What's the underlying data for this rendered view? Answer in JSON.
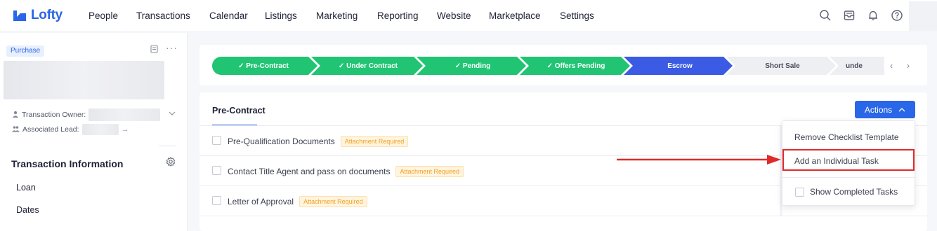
{
  "brand": {
    "name": "Lofty",
    "color": "#2a66e8"
  },
  "nav": {
    "items": [
      "People",
      "Transactions",
      "Calendar",
      "Listings",
      "Marketing",
      "Reporting",
      "Website",
      "Marketplace",
      "Settings"
    ],
    "icons": [
      "search-icon",
      "inbox-icon",
      "bell-icon",
      "help-icon"
    ]
  },
  "sidebar": {
    "tag": "Purchase",
    "owner_label": "Transaction Owner:",
    "lead_label": "Associated Lead:",
    "lead_arrow": "→",
    "section_title": "Transaction Information",
    "links": [
      "Loan",
      "Dates"
    ]
  },
  "stages": [
    {
      "label": "✓ Pre-Contract",
      "state": "done"
    },
    {
      "label": "✓ Under Contract",
      "state": "done"
    },
    {
      "label": "✓ Pending",
      "state": "done"
    },
    {
      "label": "✓ Offers Pending",
      "state": "done"
    },
    {
      "label": "Escrow",
      "state": "current"
    },
    {
      "label": "Short Sale",
      "state": "future"
    },
    {
      "label": "unde",
      "state": "future"
    }
  ],
  "colors": {
    "done": "#20c473",
    "current": "#3b5be4",
    "future": "#eeeff3",
    "highlight": "#e02a2a"
  },
  "checklist": {
    "tab": "Pre-Contract",
    "actions_label": "Actions",
    "tasks": [
      {
        "label": "Pre-Qualification Documents",
        "badge": "Attachment Required"
      },
      {
        "label": "Contact Title Agent and pass on documents",
        "badge": "Attachment Required"
      },
      {
        "label": "Letter of Approval",
        "badge": "Attachment Required"
      }
    ]
  },
  "dropdown": {
    "items": [
      "Remove Checklist Template",
      "Add an Individual Task"
    ],
    "show_completed": "Show Completed Tasks"
  }
}
